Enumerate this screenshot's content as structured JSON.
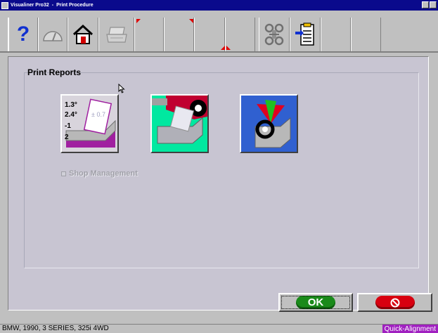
{
  "window": {
    "app_name": "Visualiner Pro32",
    "separator": "-",
    "title": "Print Procedure"
  },
  "toolbar": {
    "buttons": [
      {
        "icon": "help-icon",
        "glyph": "?"
      },
      {
        "icon": "gauge-icon"
      },
      {
        "icon": "home-icon"
      },
      {
        "icon": "printer-icon"
      },
      {
        "icon": "empty-slot"
      },
      {
        "icon": "empty-slot"
      },
      {
        "icon": "empty-slot"
      },
      {
        "icon": "empty-slot"
      },
      {
        "icon": "wheels-icon"
      },
      {
        "icon": "clipboard-import-icon"
      },
      {
        "icon": "empty-slot"
      },
      {
        "icon": "empty-slot"
      }
    ]
  },
  "panel": {
    "title": "Print Reports",
    "reports": [
      {
        "icon": "measurements-report-icon",
        "values": [
          "1.3°",
          "2.4°",
          "-1",
          "2"
        ],
        "tolerance": "± 0.7"
      },
      {
        "icon": "vehicle-report-icon"
      },
      {
        "icon": "alignment-report-icon"
      }
    ],
    "shop_management_label": "Shop Management"
  },
  "buttons": {
    "ok_label": "OK",
    "cancel_icon": "cancel-icon"
  },
  "status": {
    "vehicle": "BMW, 1990, 3 SERIES, 325i 4WD",
    "mode": "Quick-Alignment"
  },
  "colors": {
    "titlebar": "#0a0a8c",
    "ok_green": "#1a8a1a",
    "cancel_red": "#d80010",
    "mode_purple": "#a020c0"
  }
}
